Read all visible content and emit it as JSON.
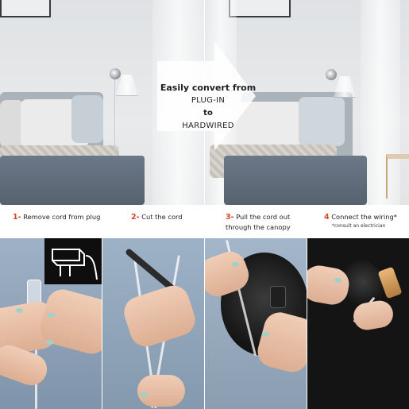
{
  "callout": {
    "line1": "Easily convert from",
    "line2": "PLUG-IN",
    "line3": "to",
    "line4": "HARDWIRED"
  },
  "steps": [
    {
      "number": "1-",
      "label": "Remove cord from plug"
    },
    {
      "number": "2-",
      "label": "Cut the cord"
    },
    {
      "number": "3-",
      "label": "Pull the cord out through the canopy"
    },
    {
      "number": "4",
      "label": "Connect the wiring*",
      "note": "*consult an electrician"
    }
  ],
  "colors": {
    "step_number": "#d7442a",
    "bedding": "#56626f",
    "wall": "#e2e4e6",
    "nail_polish": "#9ed2c7"
  },
  "photos": [
    {
      "icon": "plug-icon"
    },
    {
      "icon": "scissors-icon"
    },
    {
      "icon": "canopy-icon"
    },
    {
      "icon": "wiring-icon"
    }
  ]
}
